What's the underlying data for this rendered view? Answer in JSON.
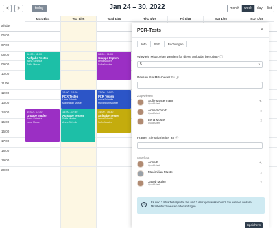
{
  "toolbar": {
    "prev_glyph": "<",
    "next_glyph": ">",
    "today_label": "today",
    "title": "Jan 24 – 30, 2022",
    "views": [
      {
        "label": "month",
        "active": false
      },
      {
        "label": "week",
        "active": true
      },
      {
        "label": "day",
        "active": false
      },
      {
        "label": "list",
        "active": false
      }
    ]
  },
  "calendar": {
    "all_day_label": "all-day",
    "days": [
      "Mon 1/24",
      "Tue 1/25",
      "Wed 1/26",
      "Thu 1/27",
      "Fri 1/28",
      "Sat 1/29",
      "Sun 1/30"
    ],
    "today_index": 1,
    "hours": [
      "06:00",
      "07:00",
      "08:00",
      "09:00",
      "10:00",
      "11:00",
      "12:00",
      "13:00",
      "14:00",
      "15:00",
      "16:00",
      "17:00",
      "18:00",
      "19:00",
      "20:00"
    ],
    "events": [
      {
        "day": 0,
        "start": 8.0,
        "end": 11.0,
        "color": "teal",
        "time": "08:00 - 11:00",
        "title": "Aufgabe Testen",
        "line1": "Anna Schmitz",
        "line2": "Sofie Muster"
      },
      {
        "day": 2,
        "start": 8.0,
        "end": 11.0,
        "color": "purple",
        "time": "08:00 - 11:00",
        "title": "Gruppe Impfen",
        "line1": "Lena Muster",
        "line2": "Sofie Muster"
      },
      {
        "day": 1,
        "start": 12.0,
        "end": 14.0,
        "color": "blue",
        "time": "12:00 - 14:00",
        "title": "PCR Testen",
        "line1": "Lena Schmitz",
        "line2": "Maximilian Muster"
      },
      {
        "day": 2,
        "start": 12.0,
        "end": 14.0,
        "color": "blue",
        "time": "12:00 - 14:00",
        "title": "PCR Testen",
        "line1": "Anna Schmitz",
        "line2": "Maximilian Muster"
      },
      {
        "day": 0,
        "start": 14.0,
        "end": 17.5,
        "color": "purple",
        "time": "14:00 - 17:30",
        "title": "Gruppe Impfen",
        "line1": "Anna Schmitz",
        "line2": "Lena Muster"
      },
      {
        "day": 1,
        "start": 14.0,
        "end": 17.5,
        "color": "teal",
        "time": "14:00 - 17:30",
        "title": "Aufgabe Testen",
        "line1": "Sofie Muster",
        "line2": "Anna Schmitz"
      },
      {
        "day": 2,
        "start": 14.0,
        "end": 16.5,
        "color": "gold",
        "time": "14:00 - 16:30",
        "title": "Aufgabe Testen",
        "line1": "Lena Schmitz",
        "line2": "Sofie Muster"
      }
    ]
  },
  "colors": {
    "teal": "#1dbfa7",
    "purple": "#9b2fc4",
    "blue": "#2c55c7",
    "gold": "#c4ac0d"
  },
  "panel": {
    "title": "PCR-Tests",
    "close_glyph": "×",
    "tabs": [
      {
        "label": "Info",
        "active": false
      },
      {
        "label": "Staff",
        "active": true
      },
      {
        "label": "Buchungen",
        "active": false
      }
    ],
    "q1_label": "Wieviele Mitarbeiter werden für diese Aufgabe benötigt?",
    "q1_value": "5",
    "q2_label": "Weisen Sie Mitarbeiter zu",
    "q2_value": "",
    "assigned_label": "Zugewiesen",
    "assigned": [
      {
        "name": "Sofie Mustermann",
        "sub": "Qualifiziert",
        "action": "✎"
      },
      {
        "name": "Anna Schmitz",
        "sub": "Qualifiziert",
        "action": "×"
      },
      {
        "name": "Lena Muster",
        "sub": "Qualifiziert",
        "action": "×"
      }
    ],
    "q3_label": "Fragen Sie Mitarbeiter an",
    "q3_value": "",
    "requested_label": "Angefragt",
    "requested": [
      {
        "name": "Anna P.",
        "sub": "Qualifiziert",
        "action": "✎"
      },
      {
        "name": "Maximilian Muster",
        "sub": "",
        "action": "×"
      },
      {
        "name": "Jakob Müller",
        "sub": "Qualifiziert",
        "action": "×"
      }
    ],
    "info_text": "Es sind 2 Mitarbeiterplätze frei und 3 Anfragen ausstehend. Sie können weitere Mitarbeiter zuweisen oder anfragen.",
    "save_label": "Speichern"
  }
}
